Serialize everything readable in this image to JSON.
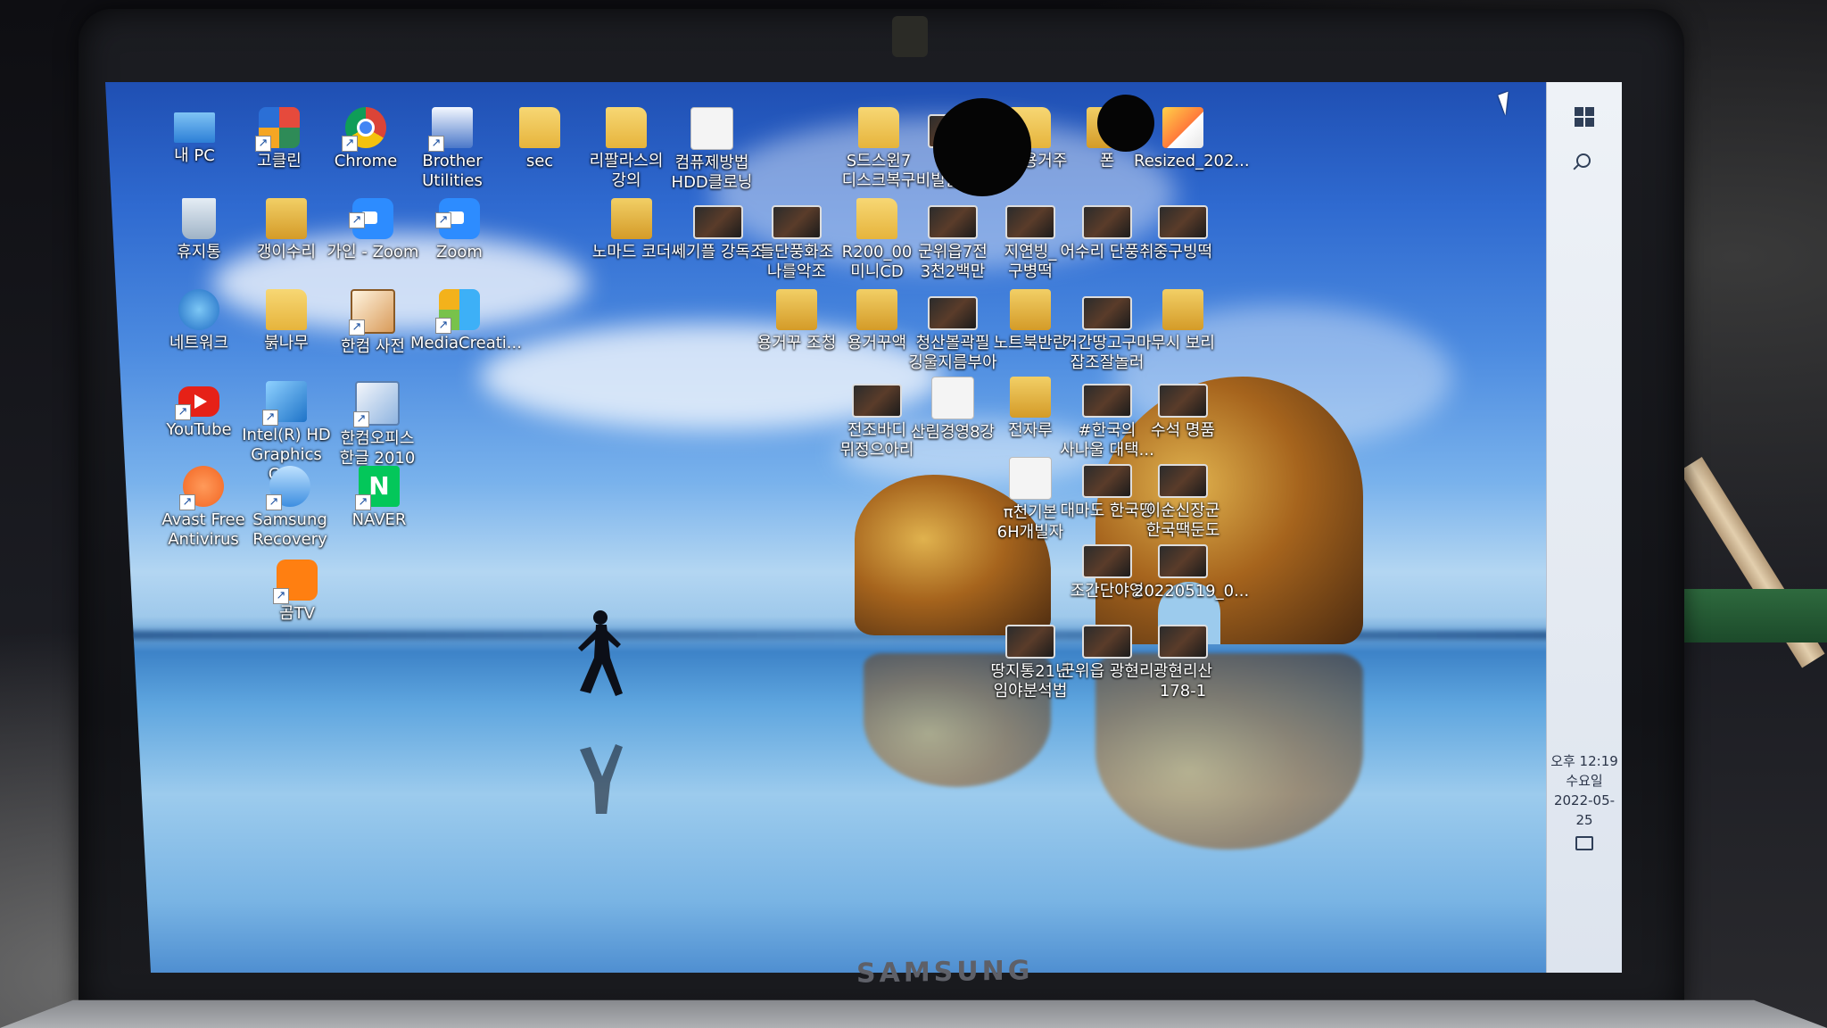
{
  "device": {
    "brand": "SAMSUNG"
  },
  "desktop_icons": [
    {
      "label": "내 PC",
      "icon": "pc-icon",
      "style": "pc",
      "shortcut": false
    },
    {
      "label": "고클린",
      "icon": "goclean-icon",
      "style": "gourmet",
      "shortcut": true
    },
    {
      "label": "Chrome",
      "icon": "chrome-icon",
      "style": "chrome",
      "shortcut": true
    },
    {
      "label": "Brother Utilities",
      "icon": "brother-icon",
      "style": "brother",
      "shortcut": true
    },
    {
      "label": "sec",
      "icon": "user-folder-icon",
      "style": "folder",
      "shortcut": false
    },
    {
      "label": "리팔라스의 강의",
      "icon": "folder-icon",
      "style": "folder",
      "shortcut": false
    },
    {
      "label": "컴퓨제방법 HDD클로닝",
      "icon": "document-icon",
      "style": "doc",
      "shortcut": false
    },
    {
      "label": "S드스윈7 디스크복구",
      "icon": "folder-icon",
      "style": "folder",
      "shortcut": false
    },
    {
      "label": "생식 비빌돌아영",
      "icon": "video-thumbnail-icon",
      "style": "thumb",
      "shortcut": false
    },
    {
      "label": "가시용거주",
      "icon": "folder-icon",
      "style": "folder",
      "shortcut": false
    },
    {
      "label": "폰",
      "icon": "folder-icon",
      "style": "folder-dark",
      "shortcut": false
    },
    {
      "label": "Resized_202...",
      "icon": "image-icon",
      "style": "image-ico",
      "shortcut": false
    },
    {
      "label": "휴지통",
      "icon": "recycle-bin-icon",
      "style": "bin",
      "shortcut": false
    },
    {
      "label": "갱이수리",
      "icon": "folder-icon",
      "style": "folder-dark",
      "shortcut": false
    },
    {
      "label": "가인 - Zoom",
      "icon": "zoom-icon",
      "style": "zoom",
      "shortcut": true
    },
    {
      "label": "Zoom",
      "icon": "zoom-icon",
      "style": "zoom",
      "shortcut": true
    },
    {
      "label": "노마드 코더",
      "icon": "folder-icon",
      "style": "folder-dark",
      "shortcut": false
    },
    {
      "label": "쎄기플 강독조",
      "icon": "video-thumbnail-icon",
      "style": "thumb",
      "shortcut": false
    },
    {
      "label": "들단풍화조 나를악조",
      "icon": "video-thumbnail-icon",
      "style": "thumb",
      "shortcut": false
    },
    {
      "label": "R200_00 미니CD",
      "icon": "folder-icon",
      "style": "folder",
      "shortcut": false
    },
    {
      "label": "군위읍7전 3천2백만",
      "icon": "video-thumbnail-icon",
      "style": "thumb",
      "shortcut": false
    },
    {
      "label": "지연빙_ 구병떡",
      "icon": "video-thumbnail-icon",
      "style": "thumb",
      "shortcut": false
    },
    {
      "label": "어수리 단풍취",
      "icon": "video-thumbnail-icon",
      "style": "thumb",
      "shortcut": false
    },
    {
      "label": "중구빙떡",
      "icon": "video-thumbnail-icon",
      "style": "thumb",
      "shortcut": false
    },
    {
      "label": "네트워크",
      "icon": "network-icon",
      "style": "net",
      "shortcut": false
    },
    {
      "label": "붉나무",
      "icon": "folder-icon",
      "style": "folder",
      "shortcut": false
    },
    {
      "label": "한컴 사전",
      "icon": "dictionary-icon",
      "style": "dict",
      "shortcut": true
    },
    {
      "label": "MediaCreati...",
      "icon": "media-creation-icon",
      "style": "mediacreation",
      "shortcut": true
    },
    {
      "label": "용거꾸 조청",
      "icon": "folder-icon",
      "style": "folder-dark",
      "shortcut": false
    },
    {
      "label": "용거꾸액",
      "icon": "folder-icon",
      "style": "folder-dark",
      "shortcut": false
    },
    {
      "label": "청산볼곽필 깅울지름부아",
      "icon": "video-thumbnail-icon",
      "style": "thumb",
      "shortcut": false
    },
    {
      "label": "노트북반란",
      "icon": "folder-icon",
      "style": "folder-dark",
      "shortcut": false
    },
    {
      "label": "거간땅고구마 잡조잘놀러",
      "icon": "video-thumbnail-icon",
      "style": "thumb",
      "shortcut": false
    },
    {
      "label": "무시 보리",
      "icon": "folder-icon",
      "style": "folder-dark",
      "shortcut": false
    },
    {
      "label": "YouTube",
      "icon": "youtube-icon",
      "style": "youtube",
      "shortcut": true
    },
    {
      "label": "Intel(R) HD Graphics Co...",
      "icon": "intel-graphics-icon",
      "style": "intel",
      "shortcut": true
    },
    {
      "label": "한컴오피스 한글 2010",
      "icon": "hancom-office-icon",
      "style": "hancom",
      "shortcut": true
    },
    {
      "label": "전조바디 뮈정으아리",
      "icon": "video-thumbnail-icon",
      "style": "thumb",
      "shortcut": false
    },
    {
      "label": "산림경영8강",
      "icon": "document-icon",
      "style": "doc",
      "shortcut": false
    },
    {
      "label": "전자루",
      "icon": "folder-icon",
      "style": "folder-dark",
      "shortcut": false
    },
    {
      "label": "#한국의 사나울 대택...",
      "icon": "video-thumbnail-icon",
      "style": "thumb",
      "shortcut": false
    },
    {
      "label": "수석 명품",
      "icon": "video-thumbnail-icon",
      "style": "thumb",
      "shortcut": false
    },
    {
      "label": "Avast Free Antivirus",
      "icon": "avast-icon",
      "style": "avast",
      "shortcut": true
    },
    {
      "label": "Samsung Recovery",
      "icon": "samsung-recovery-icon",
      "style": "samsung",
      "shortcut": true
    },
    {
      "label": "NAVER",
      "icon": "naver-icon",
      "style": "naver",
      "shortcut": true
    },
    {
      "label": "π천기본 6H개빌자",
      "icon": "document-icon",
      "style": "doc",
      "shortcut": false
    },
    {
      "label": "대마도 한국땅",
      "icon": "video-thumbnail-icon",
      "style": "thumb",
      "shortcut": false
    },
    {
      "label": "이순신장군 한국땍둔도",
      "icon": "video-thumbnail-icon",
      "style": "thumb",
      "shortcut": false
    },
    {
      "label": "곰TV",
      "icon": "gomtv-icon",
      "style": "gomtv",
      "shortcut": true
    },
    {
      "label": "조간단야영",
      "icon": "video-thumbnail-icon",
      "style": "thumb",
      "shortcut": false
    },
    {
      "label": "20220519_0...",
      "icon": "video-thumbnail-icon",
      "style": "thumb",
      "shortcut": false
    },
    {
      "label": "땅지통21년 임야분석법",
      "icon": "video-thumbnail-icon",
      "style": "thumb",
      "shortcut": false
    },
    {
      "label": "군위읍 광현리",
      "icon": "video-thumbnail-icon",
      "style": "thumb",
      "shortcut": false
    },
    {
      "label": "광현리산 178-1",
      "icon": "video-thumbnail-icon",
      "style": "thumb",
      "shortcut": false
    }
  ],
  "taskbar": {
    "start_icon": "windows-start-icon",
    "search_icon": "search-icon",
    "clock_time": "오후 12:19",
    "clock_day": "수요일",
    "clock_date": "2022-05-25",
    "notification_icon": "action-center-icon"
  }
}
